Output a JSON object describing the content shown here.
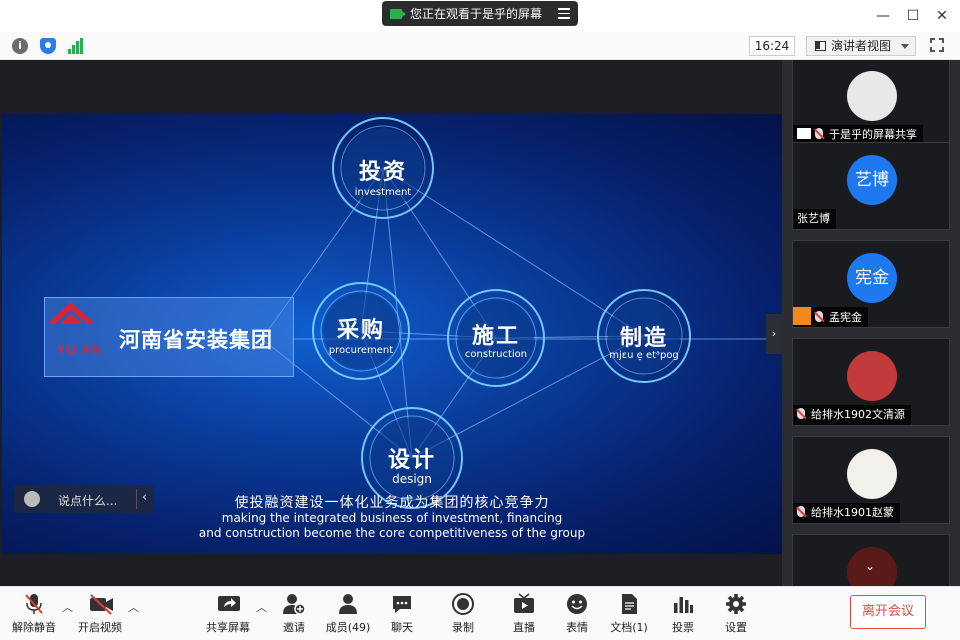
{
  "titlebar": {
    "share_status": "您正在观看于是乎的屏幕",
    "controls": {
      "minimize": "—",
      "maximize": "☐",
      "close": "✕"
    }
  },
  "top_toolbar": {
    "clock": "16:24",
    "view_mode": "演讲者视图",
    "icons": [
      "info-icon",
      "shield-icon",
      "signal-icon",
      "fullscreen-icon"
    ],
    "signal_color": "#26b050"
  },
  "slide": {
    "company_logo_text": "YU AN",
    "company_name": "河南省安装集团",
    "nodes": [
      {
        "zh": "投资",
        "en": "investment"
      },
      {
        "zh": "采购",
        "en": "procurement"
      },
      {
        "zh": "施工",
        "en": "construction"
      },
      {
        "zh": "制造",
        "en": "mjɛu e̞ etᵃpog"
      },
      {
        "zh": "设计",
        "en": "design"
      }
    ],
    "caption_zh": "使投融资建设一体化业务成为集团的核心竞争力",
    "caption_en_line1": "making the integrated business of investment, financing",
    "caption_en_line2": "and construction become the core competitiveness of the group"
  },
  "chat": {
    "placeholder": "说点什么...",
    "collapse": "‹"
  },
  "collapse_panel": "›",
  "participants": [
    {
      "name": "于是乎的屏幕共享",
      "avatar_text": "",
      "muted": true,
      "sharing": true
    },
    {
      "name": "张艺博",
      "avatar_text": "艺博",
      "muted": false
    },
    {
      "name": "孟宪金",
      "avatar_text": "宪金",
      "muted": true,
      "orange_badge": true
    },
    {
      "name": "给排水1902文清源",
      "avatar_text": "",
      "muted": true
    },
    {
      "name": "给排水1901赵蒙",
      "avatar_text": "",
      "muted": true
    },
    {
      "name": "",
      "avatar_text": "",
      "muted": false
    }
  ],
  "bottom_bar": {
    "unmute": "解除静音",
    "start_video": "开启视频",
    "share_screen": "共享屏幕",
    "invite": "邀请",
    "members": "成员(49)",
    "chat": "聊天",
    "record": "录制",
    "live": "直播",
    "reactions": "表情",
    "docs": "文档(1)",
    "vote": "投票",
    "settings": "设置",
    "leave": "离开会议"
  },
  "colors": {
    "accent_blue": "#1e78ef",
    "leave_red": "#e04a4a",
    "mute_red": "#e03a3a"
  }
}
